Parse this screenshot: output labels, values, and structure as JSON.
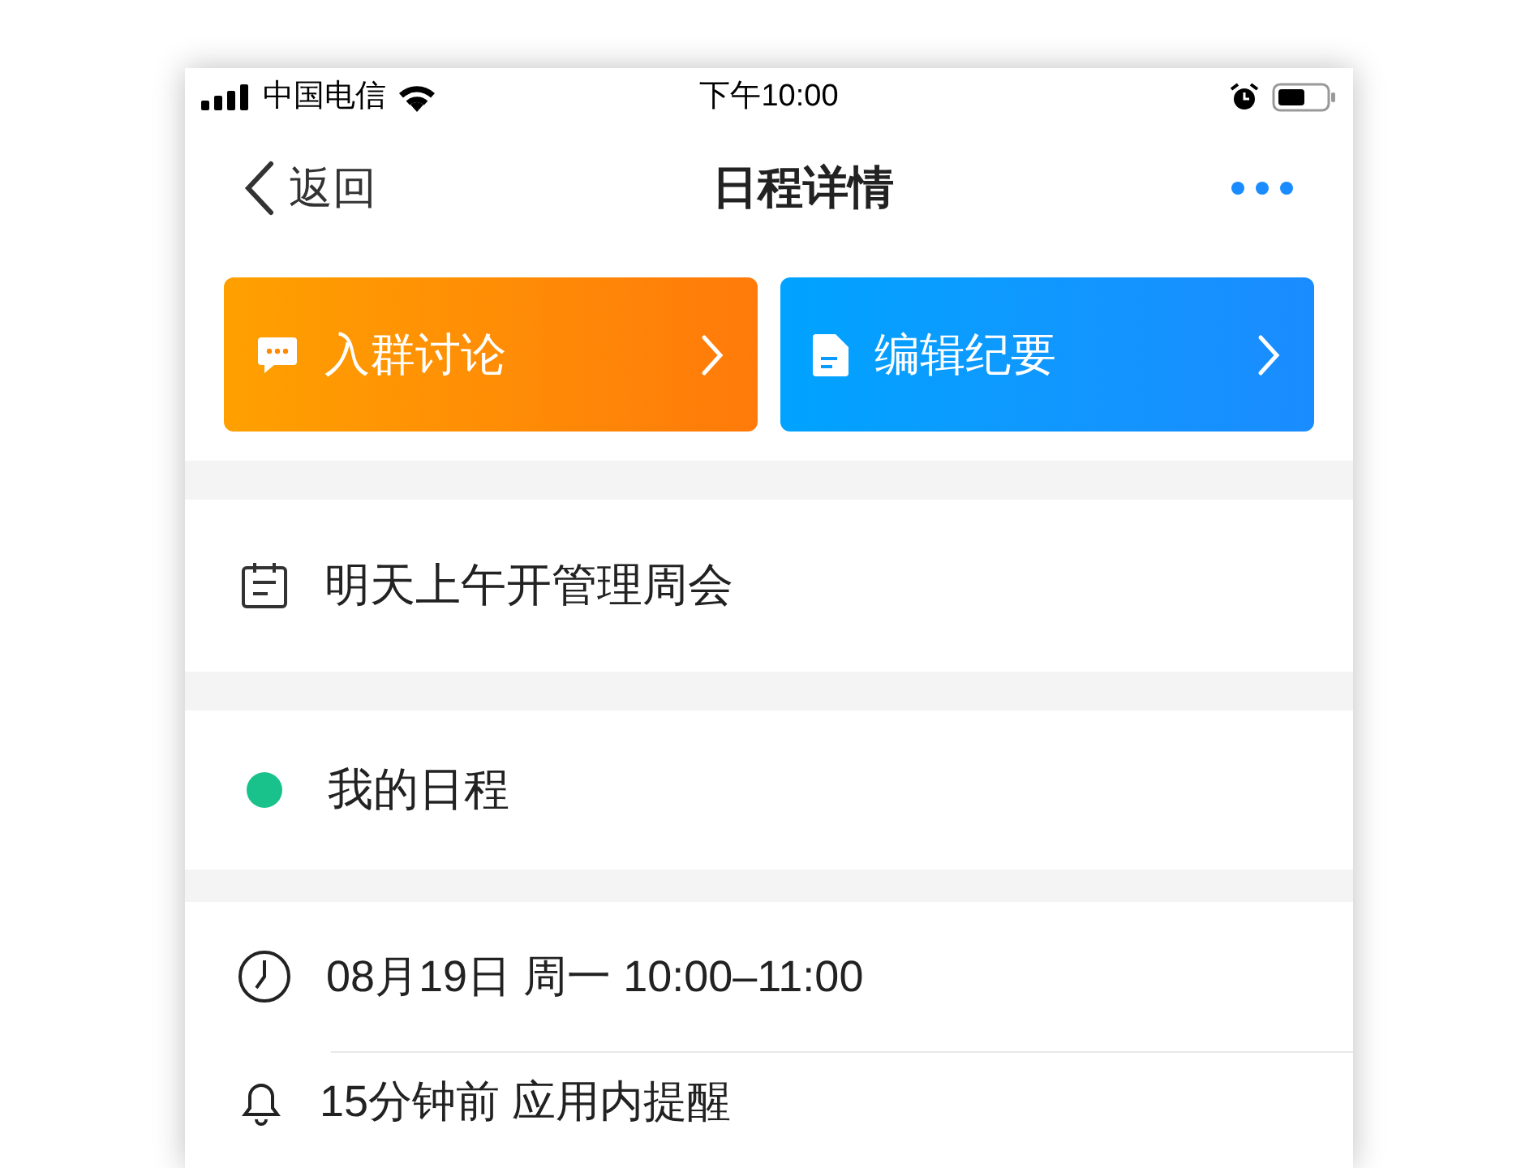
{
  "status_bar": {
    "carrier": "中国电信",
    "time": "下午10:00"
  },
  "nav": {
    "back_label": "返回",
    "title": "日程详情"
  },
  "actions": [
    {
      "kind": "chat",
      "label": "入群讨论"
    },
    {
      "kind": "doc",
      "label": "编辑纪要"
    }
  ],
  "event": {
    "title": "明天上午开管理周会"
  },
  "calendar": {
    "name": "我的日程",
    "color": "#19c28a"
  },
  "details": [
    {
      "kind": "time",
      "text": "08月19日 周一 10:00–11:00"
    },
    {
      "kind": "reminder",
      "text": "15分钟前 应用内提醒"
    }
  ]
}
